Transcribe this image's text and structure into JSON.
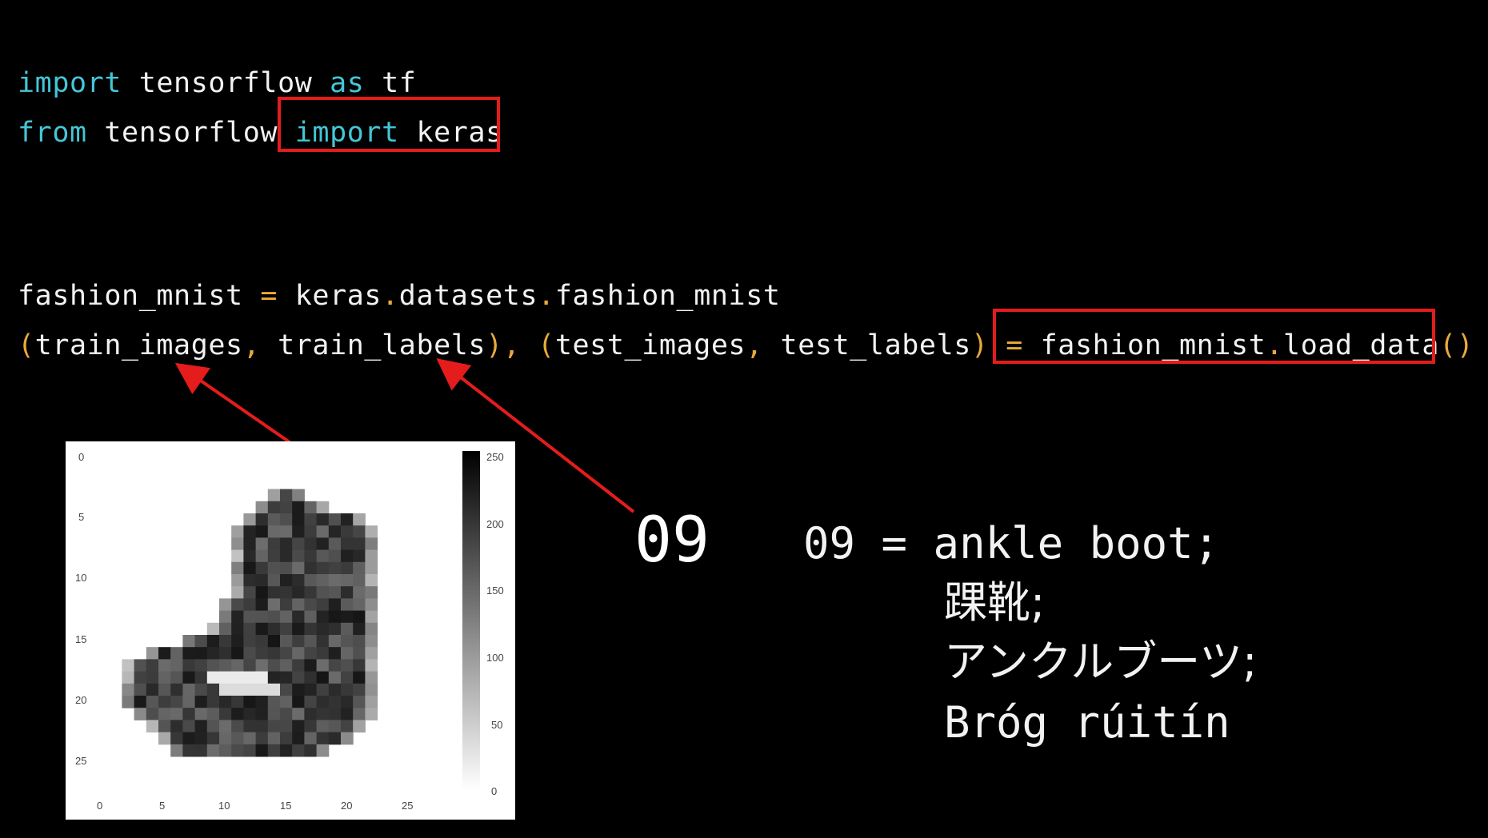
{
  "code": {
    "line1": {
      "kw1": "import",
      "mod": " tensorflow ",
      "kw2": "as",
      "alias": " tf"
    },
    "line2": {
      "kw1": "from",
      "mod": " tensorflow ",
      "kw2": "import",
      "name": " keras"
    },
    "line3": {
      "var": "fashion_mnist ",
      "eq": "=",
      "p1": " keras",
      "dot1": ".",
      "p2": "datasets",
      "dot2": ".",
      "p3": "fashion_mnist"
    },
    "line4": {
      "lp1": "(",
      "a": "train_images",
      "c1": ",",
      "b": " train_labels",
      "rp1": ")",
      "c2": ",",
      "lp2": " (",
      "c": "test_images",
      "c3": ",",
      "d": " test_labels",
      "rp2": ")",
      "eq": " =",
      "call1": " fashion_mnist",
      "dot": ".",
      "call2": "load_data",
      "parens": "()"
    }
  },
  "label_number": "09",
  "definition": {
    "line1": "09 = ankle boot;",
    "line2": "踝靴;",
    "line3": "アンクルブーツ;",
    "line4": "Bróg rúitín"
  },
  "figure": {
    "x_ticks": [
      "0",
      "5",
      "10",
      "15",
      "20",
      "25"
    ],
    "y_ticks": [
      "0",
      "5",
      "10",
      "15",
      "20",
      "25"
    ],
    "colorbar_ticks": [
      "250",
      "200",
      "150",
      "100",
      "50",
      "0"
    ]
  },
  "colors": {
    "highlight": "#e41c1c",
    "keyword": "#45c6d6",
    "operator": "#e9a93a"
  }
}
